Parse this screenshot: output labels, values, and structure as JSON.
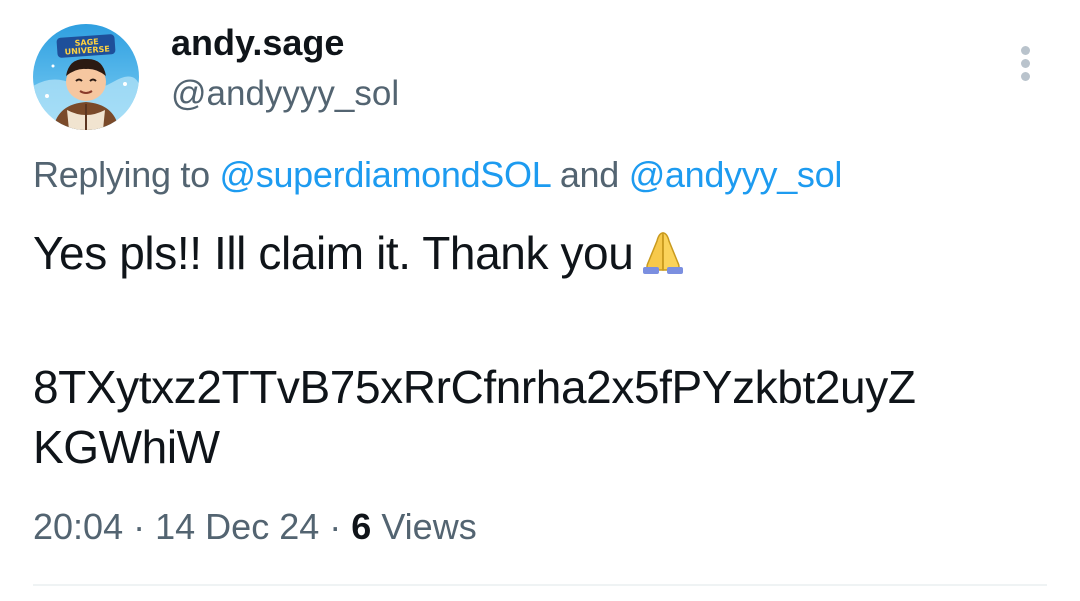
{
  "author": {
    "display_name": "andy.sage",
    "handle": "@andyyyy_sol",
    "avatar_badge_text": "SAGE UNIVERSE"
  },
  "reply_context": {
    "prefix": "Replying to",
    "mention_1": "@superdiamondSOL",
    "conjunction": "and",
    "mention_2": "@andyyy_sol"
  },
  "tweet": {
    "text_line_1": "Yes pls!! Ill claim it. Thank you",
    "emoji": "folded-hands",
    "address_line_1": "8TXytxz2TTvB75xRrCfnrha2x5fPYzkbt2uyZ",
    "address_line_2": "KGWhiW"
  },
  "meta": {
    "time": "20:04",
    "separator": "·",
    "date": "14 Dec 24",
    "views_count": "6",
    "views_label": "Views"
  },
  "icons": {
    "more": "more-vertical-icon"
  },
  "colors": {
    "text": "#0f1419",
    "secondary": "#536471",
    "link": "#1d9bf0",
    "divider": "#eff3f4"
  }
}
